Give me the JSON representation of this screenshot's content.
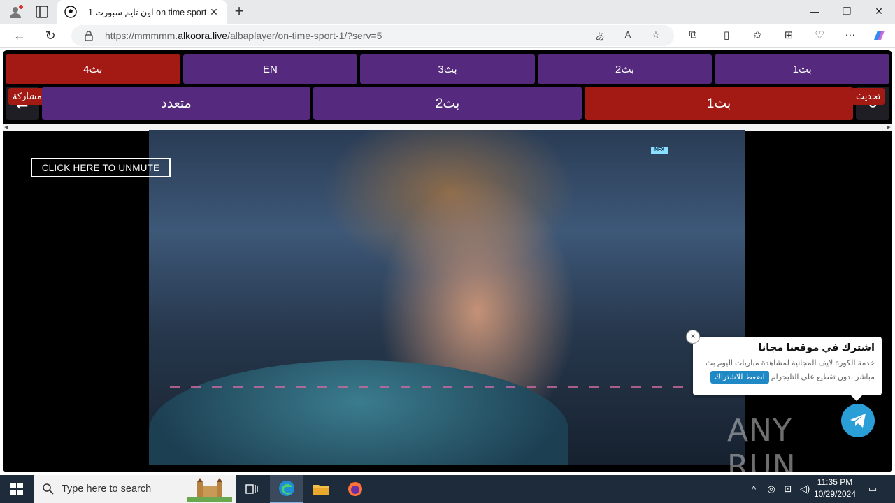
{
  "browser": {
    "tab_title": "اون تايم سبورت 1 on time sport",
    "url_prefix": "https://mmmmm.",
    "url_domain": "alkoora.live",
    "url_path": "/albaplayer/on-time-sport-1/?serv=5"
  },
  "servers_row1": [
    {
      "label": "بث1",
      "active": false
    },
    {
      "label": "بث2",
      "active": false
    },
    {
      "label": "بث3",
      "active": false
    },
    {
      "label": "EN",
      "active": false
    },
    {
      "label": "بث4",
      "active": true
    }
  ],
  "servers_row2": {
    "refresh_tag": "تحديث",
    "share_tag": "مشاركة",
    "btn1": "بث1",
    "btn2": "بث2",
    "btn3": "متعدد"
  },
  "player": {
    "unmute_label": "CLICK HERE TO UNMUTE",
    "channel_badge": "NFX"
  },
  "popup": {
    "title": "اشترك في موقعنا مجانا",
    "body": "خدمة الكورة لايف المجانية لمشاهدة مباريات اليوم بث مباشر بدون تقطيع على التليجرام",
    "button": "اضغط للاشتراك",
    "close": "x"
  },
  "watermark": "ANY RUN",
  "taskbar": {
    "search_placeholder": "Type here to search",
    "time": "11:35 PM",
    "date": "10/29/2024"
  },
  "colors": {
    "button_purple": "#54297e",
    "button_red": "#a31a15",
    "telegram_blue": "#2a9ed7"
  }
}
